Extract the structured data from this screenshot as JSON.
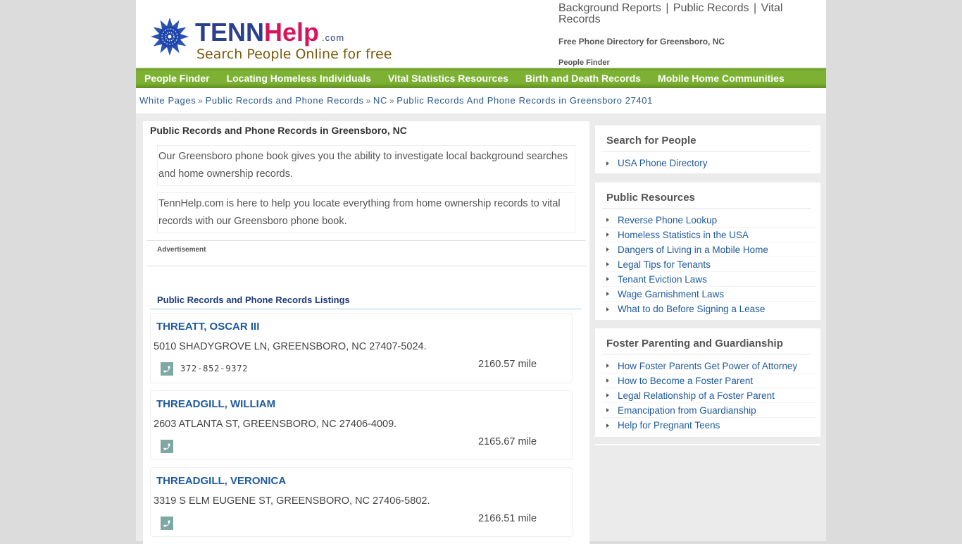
{
  "logo": {
    "brand_part1": "TENN",
    "brand_part2": "Help",
    "brand_suffix": ".com",
    "tagline": "Search People Online for free",
    "icon": "flower-logo-icon"
  },
  "header": {
    "top_links": [
      "Background Reports",
      "Public Records",
      "Vital Records"
    ],
    "separator": "|",
    "subtitle": "Free Phone Directory for Greensboro, NC",
    "subtitle2": "People Finder"
  },
  "nav": {
    "items": [
      "People Finder",
      "Locating Homeless Individuals",
      "Vital Statistics Resources",
      "Birth and Death Records",
      "Mobile Home Communities"
    ]
  },
  "breadcrumb": {
    "separator": "»",
    "items": [
      "White Pages",
      "Public Records and Phone Records",
      "NC",
      "Public Records And Phone Records in Greensboro 27401"
    ]
  },
  "main": {
    "title": "Public Records and Phone Records in Greensboro, NC",
    "intro1": "Our Greensboro phone book gives you the ability to investigate local background searches and home ownership records.",
    "intro2": "TennHelp.com is here to help you locate everything from home ownership records to vital records with our Greensboro phone book.",
    "ad_label": "Advertisement",
    "listings_title": "Public Records and Phone Records Listings",
    "listings": [
      {
        "name": "THREATT, OSCAR III",
        "address": "5010 SHADYGROVE LN, GREENSBORO, NC 27407-5024.",
        "phone": "372-852-9372",
        "distance": "2160.57 mile"
      },
      {
        "name": "THREADGILL, WILLIAM",
        "address": "2603 ATLANTA ST, GREENSBORO, NC 27406-4009.",
        "phone": "",
        "distance": "2165.67 mile"
      },
      {
        "name": "THREADGILL, VERONICA",
        "address": "3319 S ELM EUGENE ST, GREENSBORO, NC 27406-5802.",
        "phone": "",
        "distance": "2166.51 mile"
      }
    ]
  },
  "sidebar": {
    "boxes": [
      {
        "title": "Search for People",
        "links": [
          "USA Phone Directory"
        ]
      },
      {
        "title": "Public Resources",
        "links": [
          "Reverse Phone Lookup",
          "Homeless Statistics in the USA",
          "Dangers of Living in a Mobile Home",
          "Legal Tips for Tenants",
          "Tenant Eviction Laws",
          "Wage Garnishment Laws",
          "What to do Before Signing a Lease"
        ]
      },
      {
        "title": "Foster Parenting and Guardianship",
        "links": [
          "How Foster Parents Get Power of Attorney",
          "How to Become a Foster Parent",
          "Legal Relationship of a Foster Parent",
          "Emancipation from Guardianship",
          "Help for Pregnant Teens"
        ]
      }
    ]
  },
  "colors": {
    "nav_green": "#7cb133",
    "link_blue": "#1e5a9c",
    "brand_blue": "#2c3f8c",
    "brand_pink": "#d8145a",
    "tagline_brown": "#7a5a0e",
    "phone_icon_bg": "#7fa7a4"
  }
}
